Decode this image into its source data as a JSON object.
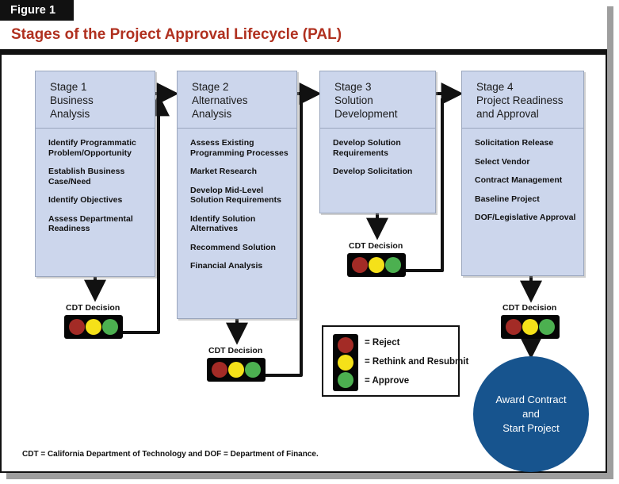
{
  "figure": {
    "tab_label": "Figure 1",
    "title": "Stages of the Project Approval Lifecycle (PAL)",
    "footnote": "CDT = California Department of Technology and DOF = Department of Finance.",
    "accent_color": "#b0301f",
    "stage_fill": "#ccd6ec",
    "circle_fill": "#17548e"
  },
  "stages": [
    {
      "heading": [
        "Stage 1",
        "Business",
        "Analysis"
      ],
      "items": [
        "Identify Programmatic\nProblem/Opportunity",
        "Establish Business\nCase/Need",
        "Identify Objectives",
        "Assess Departmental\nReadiness"
      ]
    },
    {
      "heading": [
        "Stage 2",
        "Alternatives",
        "Analysis"
      ],
      "items": [
        "Assess Existing\nProgramming Processes",
        "Market Research",
        "Develop Mid-Level\nSolution Requirements",
        "Identify Solution\nAlternatives",
        "Recommend Solution",
        "Financial Analysis"
      ]
    },
    {
      "heading": [
        "Stage 3",
        "Solution",
        "Development"
      ],
      "items": [
        "Develop Solution\nRequirements",
        "Develop Solicitation"
      ]
    },
    {
      "heading": [
        "Stage 4",
        "Project Readiness",
        "and Approval"
      ],
      "items": [
        "Solicitation Release",
        "Select Vendor",
        "Contract Management",
        "Baseline Project",
        "DOF/Legislative Approval"
      ]
    }
  ],
  "decisions": [
    {
      "label": "CDT Decision"
    },
    {
      "label": "CDT Decision"
    },
    {
      "label": "CDT Decision"
    },
    {
      "label": "CDT Decision"
    }
  ],
  "legend": {
    "rows": [
      {
        "color": "#a32b26",
        "text": "= Reject"
      },
      {
        "color": "#f5e119",
        "text": "= Rethink and Resubmit"
      },
      {
        "color": "#4cb050",
        "text": "= Approve"
      }
    ]
  },
  "outcome": {
    "lines": [
      "Award Contract",
      "and",
      "Start Project"
    ]
  }
}
